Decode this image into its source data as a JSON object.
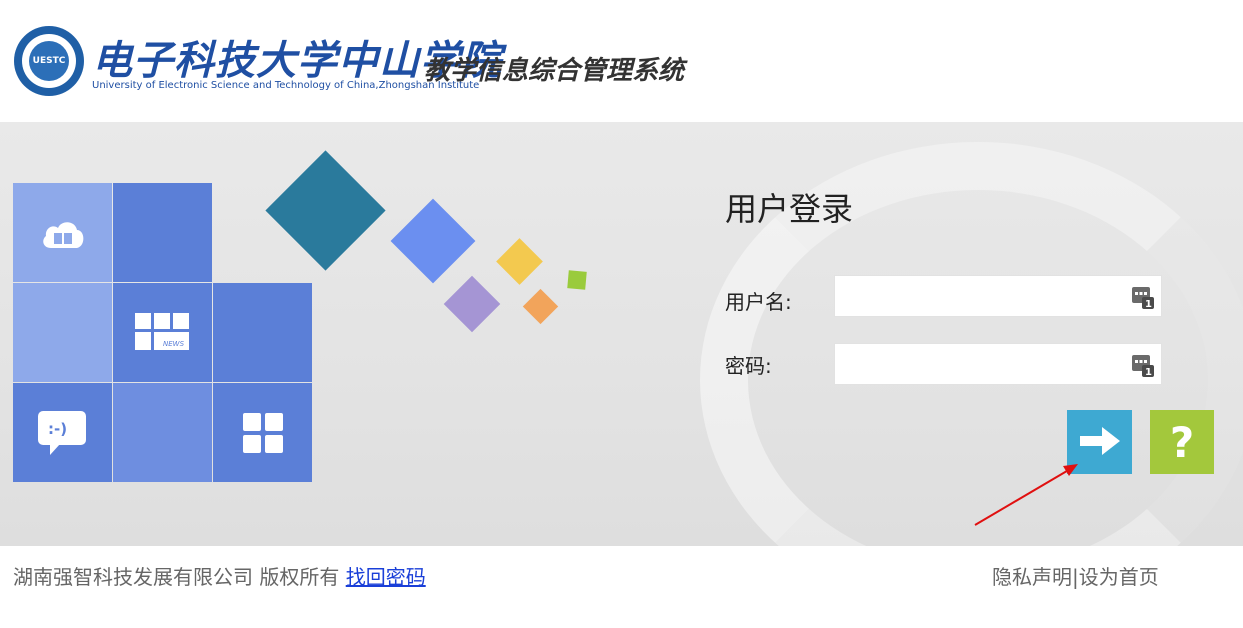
{
  "header": {
    "logo_text": "UESTC",
    "school_name_cn": "电子科技大学中山学院",
    "school_name_en": "University of Electronic Science and Technology of China,Zhongshan Institute",
    "system_title": "教学信息综合管理系统"
  },
  "banner": {
    "tiles": [
      {
        "icon": "cloud-book-icon"
      },
      {
        "icon": "news-icon",
        "label": "NEWS"
      },
      {
        "icon": "chat-bubble-icon",
        "label": ":-)"
      },
      {
        "icon": "apps-grid-icon"
      }
    ],
    "diamond_colors": [
      "#2a7a9c",
      "#6b8ff0",
      "#f3c94f",
      "#a595d4",
      "#f2a45b",
      "#9acb3c"
    ]
  },
  "login": {
    "title": "用户登录",
    "username_label": "用户名:",
    "username_value": "",
    "password_label": "密码:",
    "password_value": "",
    "login_button_icon": "arrow-right-icon",
    "help_button_label": "?"
  },
  "footer": {
    "company": "湖南强智科技发展有限公司 版权所有",
    "find_password": "找回密码",
    "privacy": "隐私声明",
    "separator": "|",
    "set_homepage": "设为首页"
  },
  "colors": {
    "brand_blue": "#1f4fa3",
    "login_button": "#3ea9d2",
    "help_button": "#a3c83c",
    "tile_light": "#8ea9ea",
    "tile_dark": "#5b7fd7",
    "link": "#1a3fd8"
  }
}
